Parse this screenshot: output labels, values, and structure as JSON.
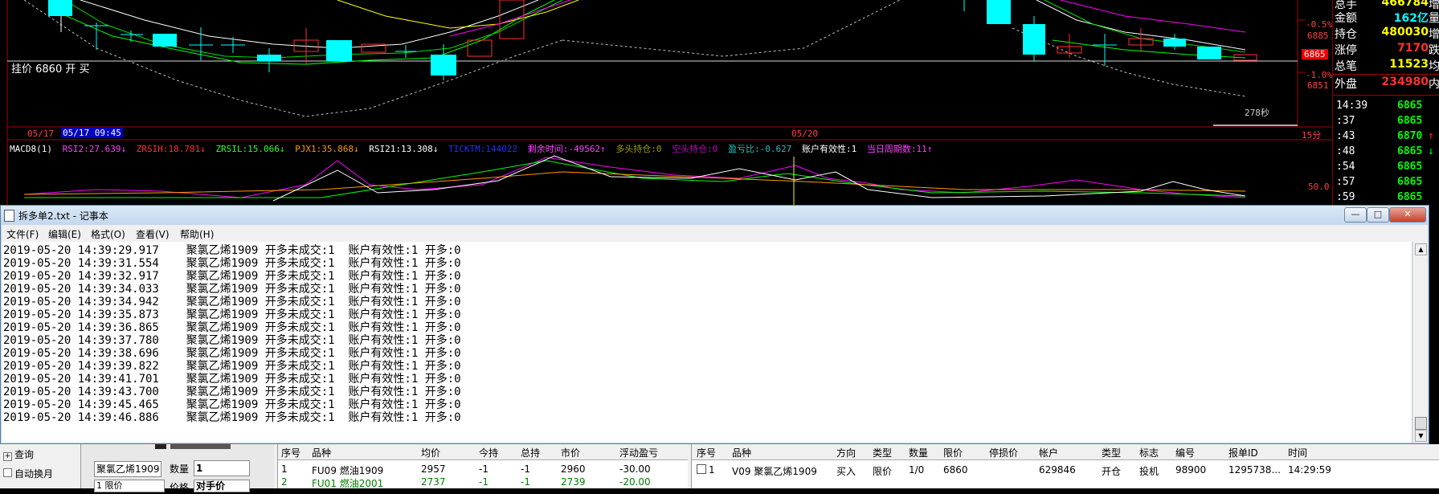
{
  "chart": {
    "guapai_label": "挂价 6860 开 买",
    "price_labels": [
      "-0.5%",
      "6885",
      "6865",
      "-1.0%",
      "6851"
    ],
    "date_left": "05/17",
    "date_selected": "05/17 09:45",
    "date_mid": "05/20",
    "timer": "278秒",
    "period": "15分",
    "level_label": "50.0",
    "indicators": [
      {
        "text": "MACD8(1)",
        "color": "#ffffff"
      },
      {
        "text": "RSI2:27.639↓",
        "color": "#ff40ff"
      },
      {
        "text": "ZRSIH:18.781↓",
        "color": "#ff3030"
      },
      {
        "text": "ZRSIL:15.066↓",
        "color": "#30ff30"
      },
      {
        "text": "PJX1:35.868↓",
        "color": "#ff9900"
      },
      {
        "text": "RSI21:13.308↓",
        "color": "#ffffff"
      },
      {
        "text": "TICKTM:144022",
        "color": "#2030ff"
      },
      {
        "text": "剩余时间:-49562↑",
        "color": "#ff40ff"
      },
      {
        "text": "多头持仓:0",
        "color": "#a0a000"
      },
      {
        "text": "空头持仓:0",
        "color": "#c000c0"
      },
      {
        "text": "盈亏比:-0.627",
        "color": "#20c0c0"
      },
      {
        "text": "账户有效性:1",
        "color": "#ffffff"
      },
      {
        "text": "当日周期数:11↑",
        "color": "#ff40ff"
      }
    ]
  },
  "quote": {
    "rows": [
      {
        "k": "总手",
        "v": "466784",
        "e": "增",
        "color": "#ffff00"
      },
      {
        "k": "金额",
        "v": "162亿",
        "e": "量",
        "color": "#00ffff"
      },
      {
        "k": "持仓",
        "v": "480030",
        "e": "增",
        "color": "#ffff00"
      },
      {
        "k": "涨停",
        "v": "7170",
        "e": "跌",
        "color": "#ff3030"
      },
      {
        "k": "总笔",
        "v": "11523",
        "e": "均",
        "color": "#ffff00"
      },
      {
        "k": "外盘",
        "v": "234980",
        "e": "内",
        "color": "#ff3030"
      }
    ],
    "ticks": [
      {
        "t": "14:39",
        "p": "6865",
        "a": ""
      },
      {
        "t": ":37",
        "p": "6865",
        "a": ""
      },
      {
        "t": ":43",
        "p": "6870",
        "a": "↑"
      },
      {
        "t": ":48",
        "p": "6865",
        "a": "↓"
      },
      {
        "t": ":54",
        "p": "6865",
        "a": ""
      },
      {
        "t": ":57",
        "p": "6865",
        "a": ""
      },
      {
        "t": ":59",
        "p": "6865",
        "a": ""
      }
    ],
    "up_color": "#ff3030",
    "down_color": "#00ff00"
  },
  "notepad": {
    "title": "拆多单2.txt - 记事本",
    "menu": [
      "文件(F)",
      "编辑(E)",
      "格式(O)",
      "查看(V)",
      "帮助(H)"
    ],
    "lines": [
      "2019-05-20 14:39:29.917    聚氯乙烯1909 开多未成交:1  账户有效性:1 开多:0",
      "2019-05-20 14:39:31.554    聚氯乙烯1909 开多未成交:1  账户有效性:1 开多:0",
      "2019-05-20 14:39:32.917    聚氯乙烯1909 开多未成交:1  账户有效性:1 开多:0",
      "2019-05-20 14:39:34.033    聚氯乙烯1909 开多未成交:1  账户有效性:1 开多:0",
      "2019-05-20 14:39:34.942    聚氯乙烯1909 开多未成交:1  账户有效性:1 开多:0",
      "2019-05-20 14:39:35.873    聚氯乙烯1909 开多未成交:1  账户有效性:1 开多:0",
      "2019-05-20 14:39:36.865    聚氯乙烯1909 开多未成交:1  账户有效性:1 开多:0",
      "2019-05-20 14:39:37.780    聚氯乙烯1909 开多未成交:1  账户有效性:1 开多:0",
      "2019-05-20 14:39:38.696    聚氯乙烯1909 开多未成交:1  账户有效性:1 开多:0",
      "2019-05-20 14:39:39.822    聚氯乙烯1909 开多未成交:1  账户有效性:1 开多:0",
      "2019-05-20 14:39:41.701    聚氯乙烯1909 开多未成交:1  账户有效性:1 开多:0",
      "2019-05-20 14:39:43.700    聚氯乙烯1909 开多未成交:1  账户有效性:1 开多:0",
      "2019-05-20 14:39:45.465    聚氯乙烯1909 开多未成交:1  账户有效性:1 开多:0",
      "2019-05-20 14:39:46.886    聚氯乙烯1909 开多未成交:1  账户有效性:1 开多:0"
    ]
  },
  "left_panel": {
    "query": "查询",
    "auto_switch": "自动换月",
    "contract": "聚氯乙烯1909",
    "qty_label": "数量",
    "qty_value": "1",
    "price_label": "价格",
    "price_value": "对手价",
    "mode_value": "1 限价"
  },
  "positions": {
    "headers": [
      "序号",
      "品种",
      "均价",
      "今持",
      "总持",
      "市价",
      "浮动盈亏"
    ],
    "rows": [
      {
        "no": "1",
        "name": "FU09 燃油1909",
        "avg": "2957",
        "today": "-1",
        "total": "-1",
        "mkt": "2960",
        "pnl": "-30.00",
        "color": "#000000"
      },
      {
        "no": "2",
        "name": "FU01 燃油2001",
        "avg": "2737",
        "today": "-1",
        "total": "-1",
        "mkt": "2739",
        "pnl": "-20.00",
        "color": "#008000"
      }
    ]
  },
  "orders": {
    "headers": [
      "序号",
      "品种",
      "方向",
      "类型",
      "数量",
      "限价",
      "停损价",
      "帐户",
      "类型",
      "标志",
      "编号",
      "报单ID",
      "时间"
    ],
    "rows": [
      {
        "no": "1",
        "name": "V09 聚氯乙烯1909",
        "dir": "买入",
        "type": "限价",
        "qty": "1/0",
        "price": "6860",
        "stop": "",
        "acct": "629846",
        "kind": "开仓",
        "flag": "投机",
        "id": "98900",
        "orderid": "1295738...",
        "time": "14:29:59"
      }
    ]
  }
}
